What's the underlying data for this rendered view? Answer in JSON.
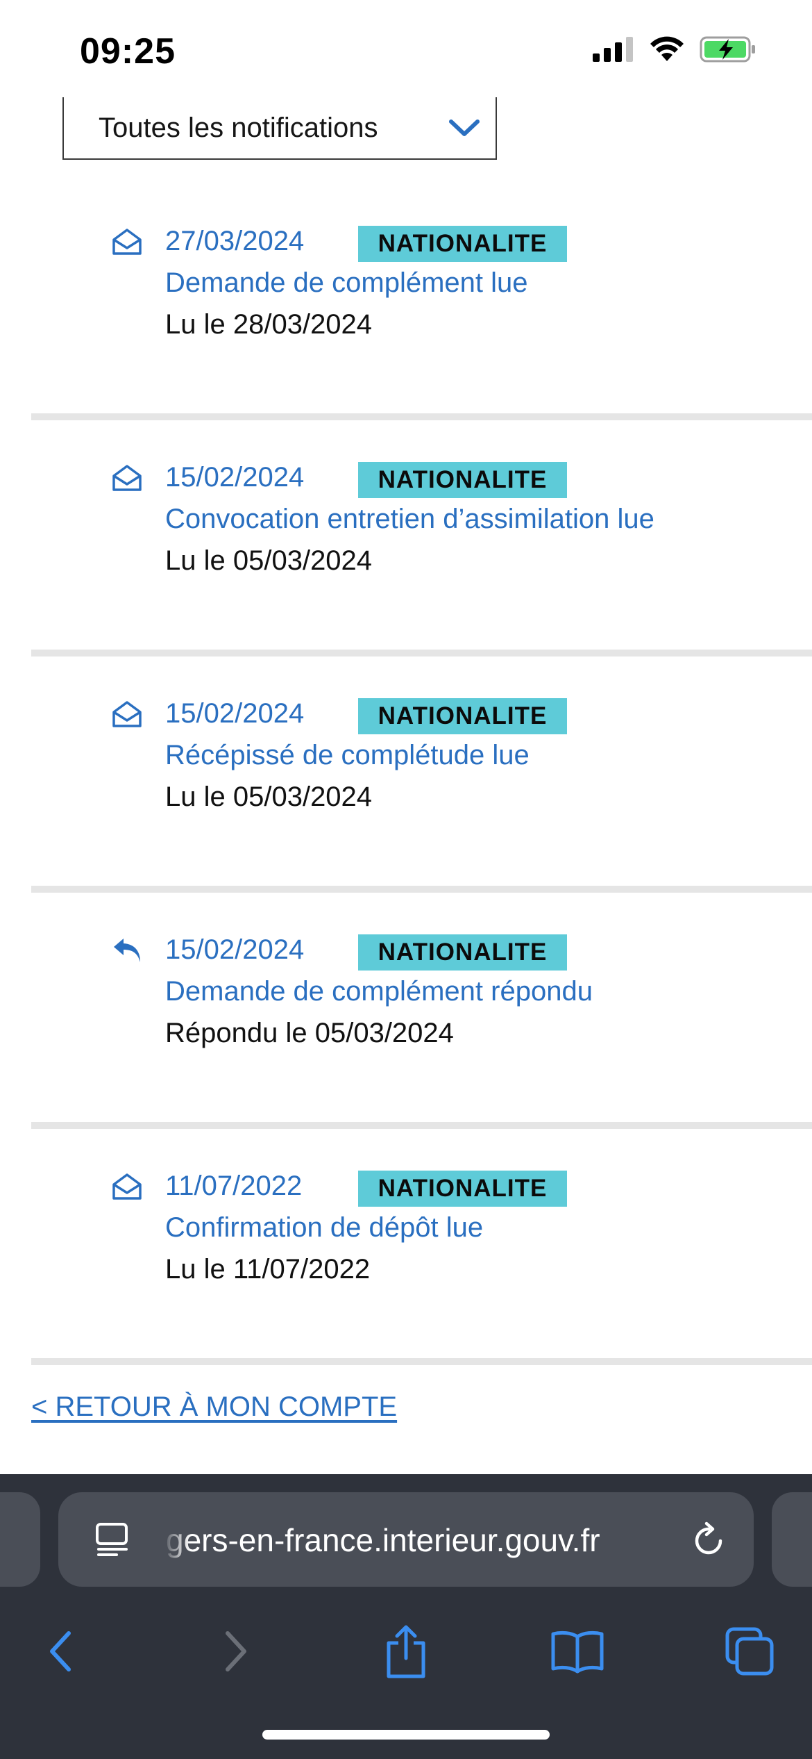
{
  "status_bar": {
    "time": "09:25",
    "icons": [
      "cellular-signal-icon",
      "wifi-icon",
      "battery-charging-icon"
    ],
    "battery_color": "#4cd964"
  },
  "filter": {
    "selected": "Toutes les notifications",
    "icon": "chevron-down-icon"
  },
  "notifications": [
    {
      "icon": "envelope-open-icon",
      "date": "27/03/2024",
      "tag": "NATIONALITE",
      "title": "Demande de complément lue",
      "status": "Lu le 28/03/2024"
    },
    {
      "icon": "envelope-open-icon",
      "date": "15/02/2024",
      "tag": "NATIONALITE",
      "title": "Convocation entretien d’assimilation lue",
      "status": "Lu le 05/03/2024"
    },
    {
      "icon": "envelope-open-icon",
      "date": "15/02/2024",
      "tag": "NATIONALITE",
      "title": "Récépissé de complétude lue",
      "status": "Lu le 05/03/2024"
    },
    {
      "icon": "reply-icon",
      "date": "15/02/2024",
      "tag": "NATIONALITE",
      "title": "Demande de complément répondu",
      "status": "Répondu le 05/03/2024"
    },
    {
      "icon": "envelope-open-icon",
      "date": "11/07/2022",
      "tag": "NATIONALITE",
      "title": "Confirmation de dépôt lue",
      "status": "Lu le 11/07/2022"
    }
  ],
  "back_link": "< RETOUR À MON COMPTE",
  "browser": {
    "url": "gers-en-france.interieur.gouv.fr",
    "toolbar_icons": [
      "back-icon",
      "forward-icon",
      "share-icon",
      "bookmarks-icon",
      "tabs-icon"
    ]
  },
  "colors": {
    "link_blue": "#2a6fc0",
    "tag_bg": "#5ecbd8",
    "divider": "#e5e5e5",
    "browser_bg": "#2e323b",
    "toolbar_blue": "#3b8ef0"
  }
}
